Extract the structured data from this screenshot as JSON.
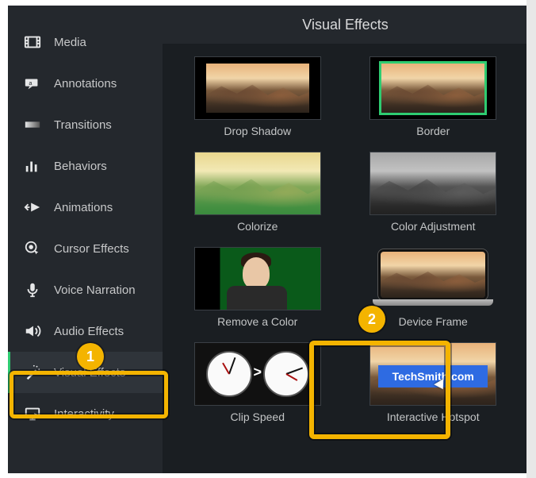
{
  "header": {
    "title": "Visual Effects"
  },
  "sidebar": {
    "items": [
      {
        "label": "Media"
      },
      {
        "label": "Annotations"
      },
      {
        "label": "Transitions"
      },
      {
        "label": "Behaviors"
      },
      {
        "label": "Animations"
      },
      {
        "label": "Cursor Effects"
      },
      {
        "label": "Voice Narration"
      },
      {
        "label": "Audio Effects"
      },
      {
        "label": "Visual Effects"
      },
      {
        "label": "Interactivity"
      }
    ]
  },
  "effects": [
    {
      "label": "Drop Shadow"
    },
    {
      "label": "Border"
    },
    {
      "label": "Colorize"
    },
    {
      "label": "Color Adjustment"
    },
    {
      "label": "Remove a Color"
    },
    {
      "label": "Device Frame"
    },
    {
      "label": "Clip Speed"
    },
    {
      "label": "Interactive Hotspot"
    }
  ],
  "hotspot_banner": "TechSmith.com",
  "clipspeed_symbol": ">",
  "annotations": {
    "badge1": "1",
    "badge2": "2"
  },
  "colors": {
    "accent": "#2ecc71",
    "callout": "#f4b400",
    "hotspot_blue": "#2e6be2"
  }
}
